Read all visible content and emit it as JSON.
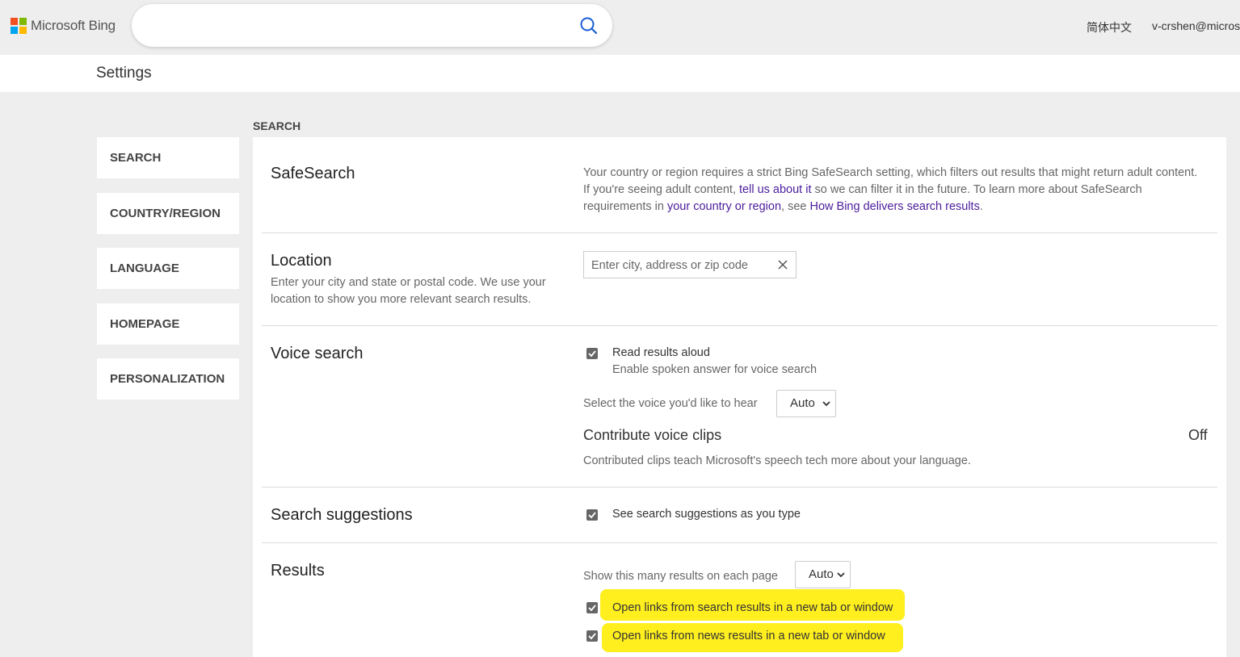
{
  "header": {
    "logo_text": "Microsoft Bing",
    "search_placeholder": "",
    "language_link": "简体中文",
    "user_email": "v-crshen@micros",
    "colors": {
      "red": "#f25022",
      "green": "#7fba00",
      "blue": "#00a4ef",
      "yellow": "#ffb900",
      "search_icon": "#1a5fd4"
    }
  },
  "settings_bar": {
    "title": "Settings"
  },
  "nav": {
    "items": [
      {
        "label": "SEARCH"
      },
      {
        "label": "COUNTRY/REGION"
      },
      {
        "label": "LANGUAGE"
      },
      {
        "label": "HOMEPAGE"
      },
      {
        "label": "PERSONALIZATION"
      }
    ]
  },
  "main": {
    "section_heading": "SEARCH",
    "safesearch": {
      "title": "SafeSearch",
      "text_1": "Your country or region requires a strict Bing SafeSearch setting, which filters out results that might return adult content. If you're seeing adult content, ",
      "link_1": "tell us about it",
      "text_2": " so we can filter it in the future. To learn more about SafeSearch requirements in ",
      "link_2": "your country or region",
      "text_3": ", see ",
      "link_3": "How Bing delivers search results",
      "text_4": "."
    },
    "location": {
      "title": "Location",
      "description": "Enter your city and state or postal code. We use your location to show you more relevant search results.",
      "placeholder": "Enter city, address or zip code"
    },
    "voice_search": {
      "title": "Voice search",
      "read_aloud_label": "Read results aloud",
      "read_aloud_desc": "Enable spoken answer for voice search",
      "voice_select_label": "Select the voice you'd like to hear",
      "voice_select_value": "Auto",
      "contribute_title": "Contribute voice clips",
      "contribute_status": "Off",
      "contribute_desc": "Contributed clips teach Microsoft's speech tech more about your language."
    },
    "search_suggestions": {
      "title": "Search suggestions",
      "checkbox_label": "See search suggestions as you type"
    },
    "results": {
      "title": "Results",
      "count_label": "Show this many results on each page",
      "count_value": "Auto",
      "open_search_label": "Open links from search results in a new tab or window",
      "open_news_label": "Open links from news results in a new tab or window",
      "highlight_color": "#ffef1f"
    }
  }
}
